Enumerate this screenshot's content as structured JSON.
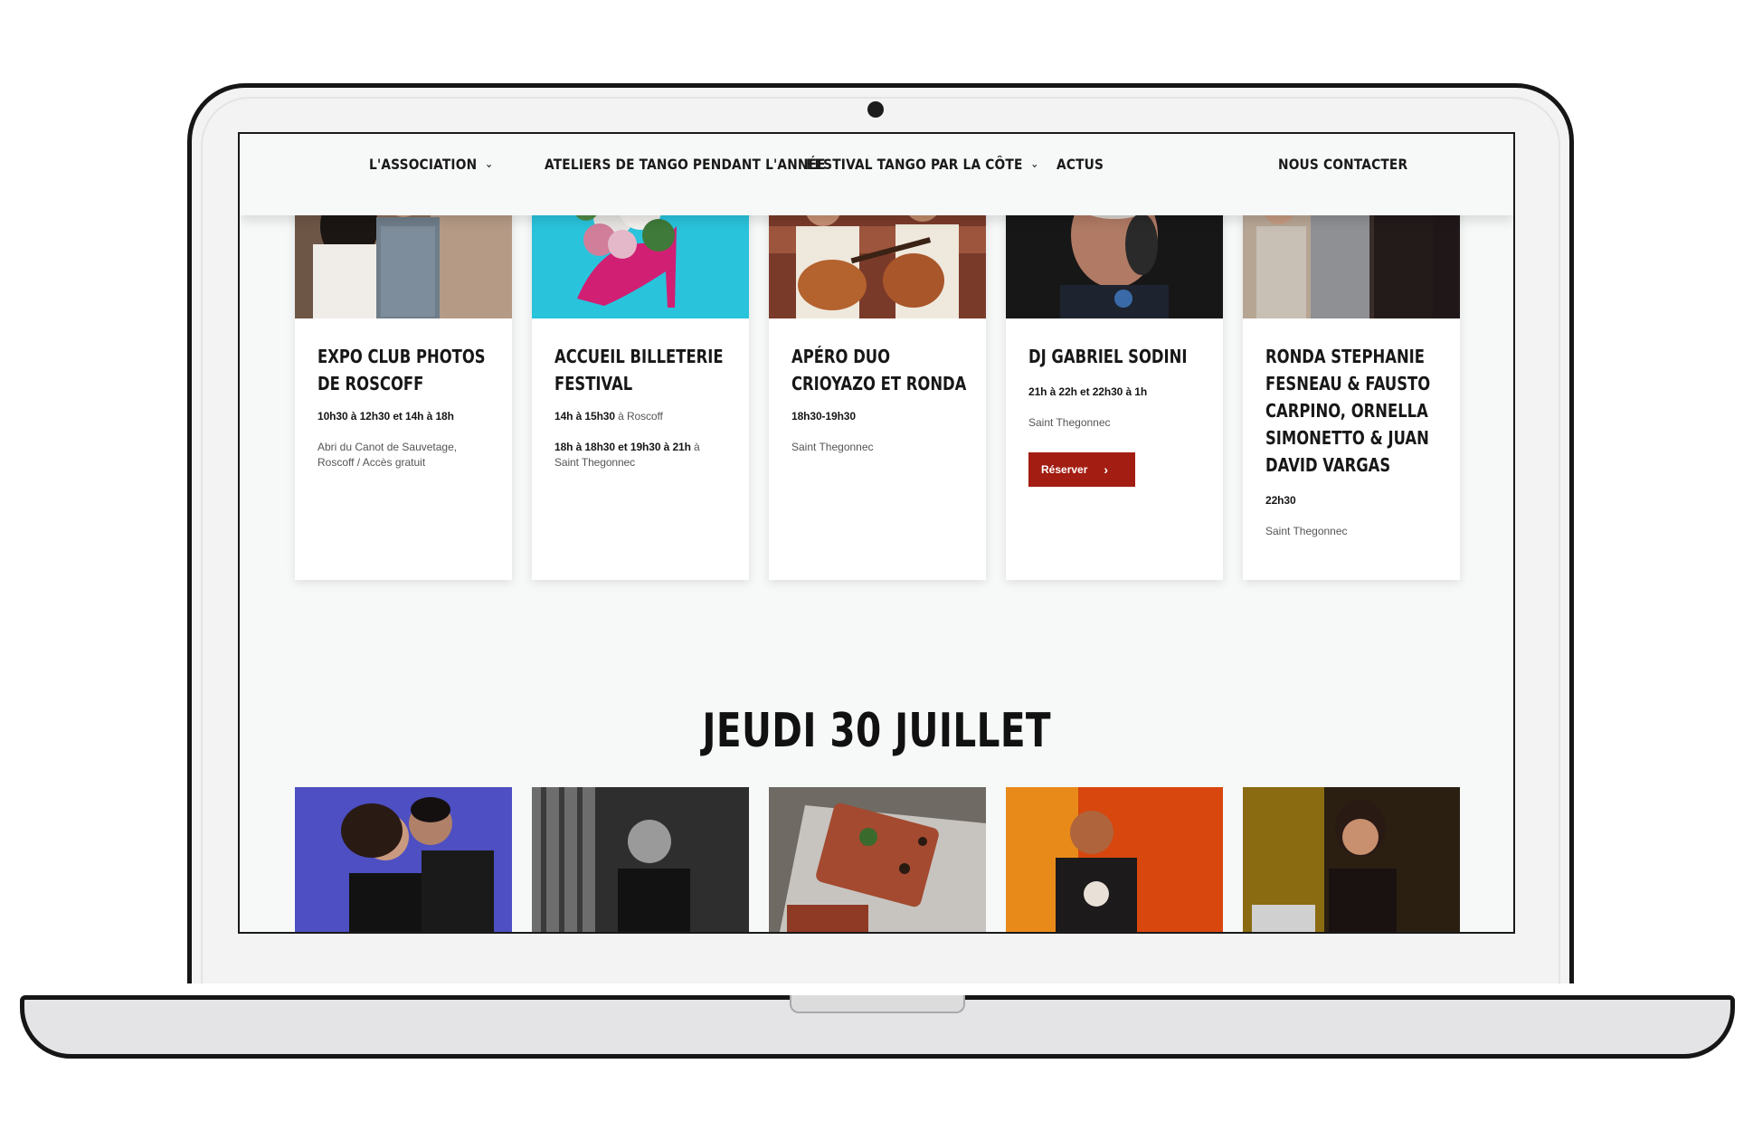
{
  "nav": {
    "items": [
      {
        "label": "L'ASSOCIATION",
        "dropdown": true
      },
      {
        "label": "ATELIERS DE TANGO PENDANT L'ANNÉE",
        "dropdown": false
      },
      {
        "label": "FESTIVAL TANGO PAR LA CÔTE",
        "dropdown": true
      },
      {
        "label": "ACTUS",
        "dropdown": false
      },
      {
        "label": "NOUS CONTACTER",
        "dropdown": false
      }
    ],
    "chevron": "⌄"
  },
  "cards": [
    {
      "title": "EXPO CLUB PHOTOS DE ROSCOFF",
      "time": "10h30 à 12h30 et 14h à 18h",
      "location": "Abri du Canot de Sauvetage, Roscoff / Accès gratuit"
    },
    {
      "title": "ACCUEIL BILLETERIE FESTIVAL",
      "time": "14h à 15h30",
      "time_suffix": " à Roscoff",
      "time2": "18h à 18h30 et 19h30 à 21h",
      "time2_suffix": " à Saint Thegonnec"
    },
    {
      "title": "APÉRO DUO CRIOYAZO ET RONDA",
      "time": "18h30-19h30",
      "location": "Saint Thegonnec"
    },
    {
      "title": "DJ GABRIEL SODINI",
      "time": "21h à 22h et 22h30 à 1h",
      "location": "Saint Thegonnec",
      "button": "Réserver",
      "button_arrow": "›"
    },
    {
      "title": "RONDA STEPHANIE FESNEAU & FAUSTO CARPINO, ORNELLA SIMONETTO & JUAN DAVID VARGAS",
      "time": "22h30",
      "location": "Saint Thegonnec"
    }
  ],
  "section": {
    "title": "JEUDI 30 JUILLET"
  },
  "colors": {
    "accent": "#a31d12",
    "background": "#f7f8f8",
    "text": "#171717"
  }
}
